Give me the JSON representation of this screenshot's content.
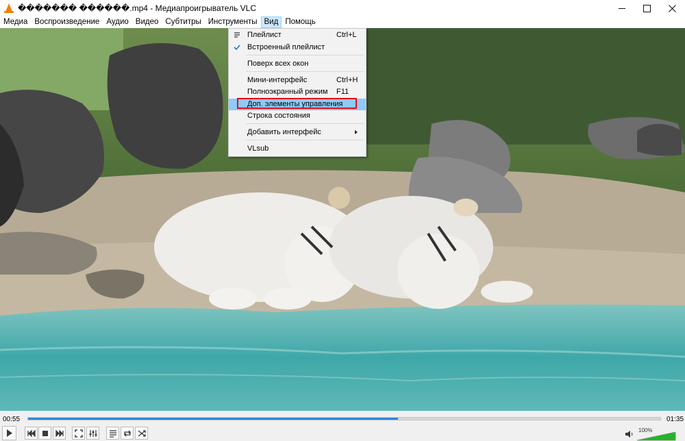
{
  "window": {
    "title": "������� ������.mp4 - Медиапроигрыватель VLC",
    "controls": [
      "minimize",
      "maximize",
      "close"
    ]
  },
  "menubar": {
    "items": [
      {
        "label": "Медиа",
        "active": false
      },
      {
        "label": "Воспроизведение",
        "active": false
      },
      {
        "label": "Аудио",
        "active": false
      },
      {
        "label": "Видео",
        "active": false
      },
      {
        "label": "Субтитры",
        "active": false
      },
      {
        "label": "Инструменты",
        "active": false
      },
      {
        "label": "Вид",
        "active": true
      },
      {
        "label": "Помощь",
        "active": false
      }
    ]
  },
  "view_menu": {
    "items": [
      {
        "label": "Плейлист",
        "shortcut": "Ctrl+L",
        "icon": "playlist-icon"
      },
      {
        "label": "Встроенный плейлист",
        "shortcut": "",
        "icon": "checkmark-icon",
        "checked": true
      },
      {
        "label": "Поверх всех окон",
        "shortcut": ""
      },
      {
        "label": "Мини-интерфейс",
        "shortcut": "Ctrl+H"
      },
      {
        "label": "Полноэкранный режим",
        "shortcut": "F11"
      },
      {
        "label": "Доп. элементы управления",
        "shortcut": "",
        "highlighted": true
      },
      {
        "label": "Строка состояния",
        "shortcut": ""
      },
      {
        "label": "Добавить интерфейс",
        "shortcut": "",
        "submenu": true
      },
      {
        "label": "VLsub",
        "shortcut": ""
      }
    ]
  },
  "playback": {
    "elapsed": "00:55",
    "total": "01:35",
    "progress": 0.585
  },
  "volume": {
    "label": "100%",
    "level": 1.0
  },
  "colors": {
    "accent": "#2e86d9",
    "menu_highlight": "#91c9f7",
    "annotation_box": "#e0101c",
    "volume_green": "#27b427"
  }
}
